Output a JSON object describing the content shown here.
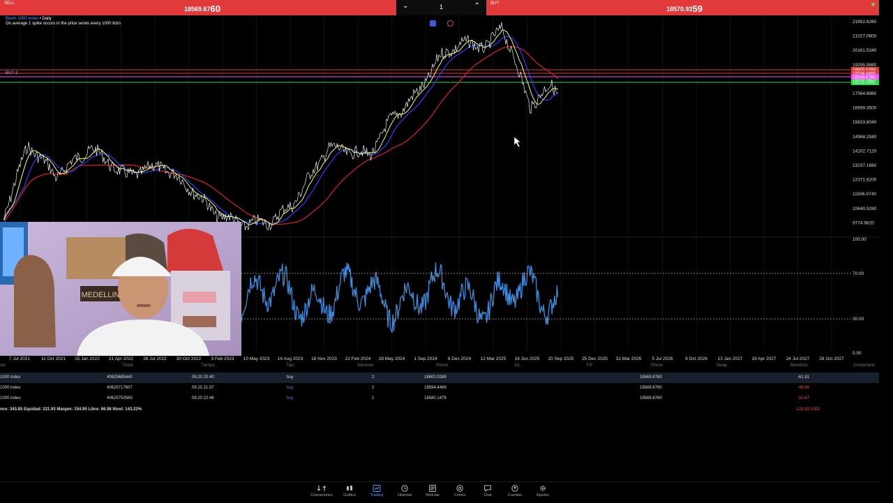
{
  "topbar": {
    "sell_label": "SELL",
    "sell_price_main": "18569.67",
    "sell_price_big": "60",
    "volume": "1",
    "buy_label": "BUY",
    "buy_price_main": "18570.93",
    "buy_price_big": "59",
    "down_icon": "chevron-down-icon",
    "up_icon": "chevron-up-icon"
  },
  "chart": {
    "symbol": "Boom 1000 Index",
    "timeframe": "Daily",
    "note": "On average 1 spike occurs in the price series every 1000 ticks",
    "buy_line_label": "BUY 2",
    "price_ticks": [
      "21892.6260",
      "21027.0800",
      "20161.5340",
      "19295.9880",
      "18430.4420",
      "17564.8960",
      "16699.3500",
      "15833.8040",
      "14968.2580",
      "14102.7120",
      "13237.1660",
      "12371.6200",
      "11506.0740",
      "10640.5280",
      "9774.9820"
    ],
    "current_price_tag": "18215.0995",
    "price_levels": {
      "red1": "18600.0289",
      "red2": "18594.4469",
      "magenta": "18569.6760",
      "green": "18215.0995"
    },
    "osc_ticks": [
      "100.00",
      "70.00",
      "30.00",
      "0.00"
    ],
    "date_ticks": [
      "7 Jul 2021",
      "11 Oct 2021",
      "15 Jan 2022",
      "21 Apr 2022",
      "28 Jul 2022",
      "30 Oct 2022",
      "3 Feb 2023",
      "10 May 2023",
      "14 Aug 2023",
      "18 Nov 2023",
      "22 Feb 2024",
      "28 May 2024",
      "1 Sep 2024",
      "6 Dec 2024",
      "12 Mar 2025",
      "16 Jun 2025",
      "20 Sep 2025",
      "25 Dec 2025",
      "31 Mar 2026",
      "5 Jul 2026",
      "9 Oct 2026",
      "13 Jan 2027",
      "19 Apr 2027",
      "24 Jul 2027",
      "28 Oct 2027"
    ],
    "colors": {
      "price": "#e8f7f0",
      "ma_fast": "#ffff55",
      "ma_mid": "#2244ff",
      "ma_slow": "#e02020",
      "osc": "#3b8de0",
      "buy_line": "#ff4aff",
      "level_green": "#22dd44"
    }
  },
  "chart_data": {
    "type": "line",
    "xlim": [
      "7 Jul 2021",
      "28 Oct 2027"
    ],
    "ylim": [
      9774.982,
      21892.626
    ],
    "series": [],
    "levels": [
      18600.0289,
      18594.4469,
      18569.676,
      18215.0995
    ],
    "oscillator_ylim": [
      0,
      100
    ],
    "oscillator_levels": [
      70,
      30
    ]
  },
  "table": {
    "headers": [
      "olo",
      "Ticket",
      "Tiempo",
      "Tipo",
      "Volumen",
      "Precio",
      "S/L",
      "T/P",
      "Precio",
      "Swap",
      "Beneficio",
      "Comentario"
    ],
    "rows": [
      {
        "symbol": "1000 index",
        "ticket": "40625685440",
        "time": "09.20 20:40",
        "type": "buy",
        "volume": "2",
        "price": "18600.0289",
        "sl": "",
        "tp": "",
        "current": "18569.6760",
        "swap": "",
        "profit": "-61.91"
      },
      {
        "symbol": "1000 index",
        "ticket": "40625717607",
        "time": "09.20 21:37",
        "type": "buy",
        "volume": "2",
        "price": "18594.4469",
        "sl": "",
        "tp": "",
        "current": "18569.6760",
        "swap": "",
        "profit": "-49.54"
      },
      {
        "symbol": "1000 index",
        "ticket": "40625753565",
        "time": "09.20 22:46",
        "type": "buy",
        "volume": "1",
        "price": "18580.1479",
        "sl": "",
        "tp": "",
        "current": "18569.6760",
        "swap": "",
        "profit": "-10.47"
      }
    ],
    "summary": "nce: 343.85 Equidad: 221.93 Margen: 154.95 Libre: 66.98 Nivel: 143.23%",
    "total": "-121.92  USD"
  },
  "nav": [
    {
      "label": "Cotizaciones",
      "icon": "quotes-icon"
    },
    {
      "label": "Gráfico",
      "icon": "chart-icon"
    },
    {
      "label": "Trading",
      "icon": "trading-icon"
    },
    {
      "label": "Historial",
      "icon": "history-icon"
    },
    {
      "label": "Noticias",
      "icon": "news-icon"
    },
    {
      "label": "Correo",
      "icon": "mail-icon"
    },
    {
      "label": "Chat",
      "icon": "chat-icon"
    },
    {
      "label": "Cuentas",
      "icon": "accounts-icon"
    },
    {
      "label": "Ajustes",
      "icon": "settings-icon"
    }
  ]
}
